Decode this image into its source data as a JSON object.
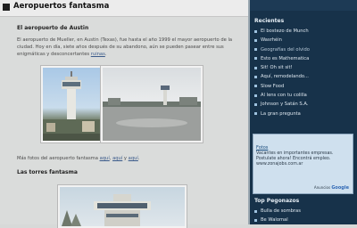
{
  "post": {
    "title": "Aeropuertos fantasma",
    "subtitle": "El aeropuerto de Austin",
    "paragraph": "El aeropuerto de Mueller, en Austin (Texas), fue hasta el año 1999 el mayor aeropuerto de la ciudad. Hoy en día, siete años después de su abandono, aún se pueden pasear entre sus enigmáticas y desconcertantes ",
    "paragraph_link": "ruinas",
    "more_photos_text": "Más fotos del aeropuerto fantasma ",
    "more_links": [
      "aquí",
      "aquí",
      "aquí"
    ],
    "section2_title": "Las torres fantasma"
  },
  "sidebar": {
    "recent_title": "Recientes",
    "recent_items": [
      "El bostezo de Munch",
      "Wasrhéin",
      "Geografías del olvido",
      "Esto es Mathematica",
      "Sit! Oh sit sit!",
      "Aquí, remodelando...",
      "Slow Food",
      "Al lens con tu colilla",
      "Johnson y Satán S.A.",
      "La gran pregunta"
    ],
    "ad": {
      "link": "Fotos",
      "text": "Vacantes en importantes empresas. Postulate ahora! Encontrá empleo. www.zonajobs.com.ar",
      "footer_label": "Anuncios",
      "footer_brand": "Google"
    },
    "top_title": "Top Pegonazos",
    "top_items": [
      "Bulla de sombras",
      "Be Walomal"
    ]
  }
}
